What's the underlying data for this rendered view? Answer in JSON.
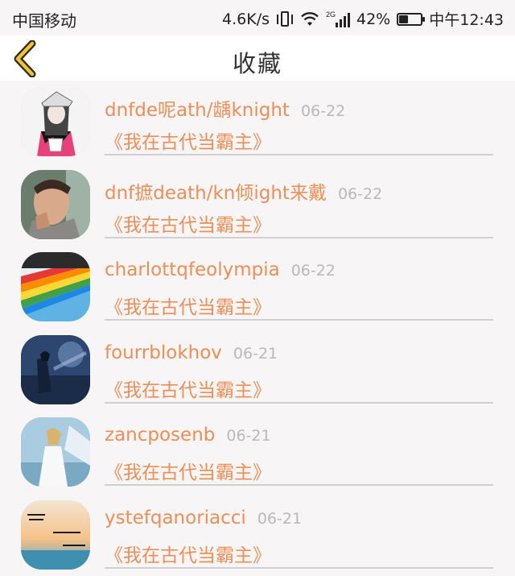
{
  "status_bar": {
    "carrier": "中国移动",
    "net_speed": "4.6K/s",
    "network_type": "2G",
    "battery": "42%",
    "battery_level": 0.42,
    "time": "中午12:43"
  },
  "nav": {
    "title": "收藏",
    "back_icon": "chevron-left-icon",
    "accent_color": "#f2c230"
  },
  "items": [
    {
      "username": "dnfde呢ath/龋knight",
      "date": "06-22",
      "book": "《我在古代当霸主》"
    },
    {
      "username": "dnf摭death/kn倾ight来戴",
      "date": "06-22",
      "book": "《我在古代当霸主》"
    },
    {
      "username": "charlottqfeolympia",
      "date": "06-22",
      "book": "《我在古代当霸主》"
    },
    {
      "username": "fourrblokhov",
      "date": "06-21",
      "book": "《我在古代当霸主》"
    },
    {
      "username": "zancposenb",
      "date": "06-21",
      "book": "《我在古代当霸主》"
    },
    {
      "username": "ystefqanoriacci",
      "date": "06-21",
      "book": "《我在古代当霸主》"
    }
  ],
  "colors": {
    "name": "#ee8e57",
    "date": "#b9b9b9",
    "background": "#f7f5f6"
  }
}
